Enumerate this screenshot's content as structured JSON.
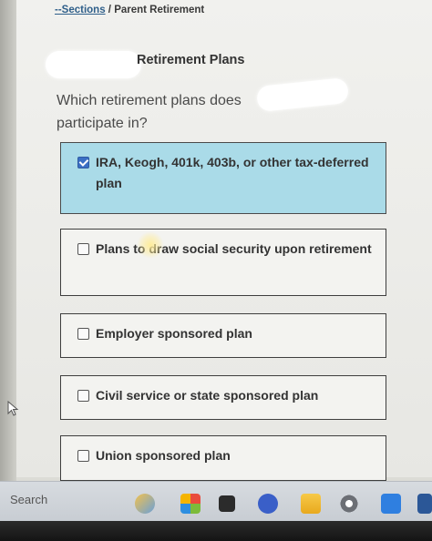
{
  "breadcrumb": {
    "link": "--Sections",
    "separator": " / ",
    "current": "Parent Retirement"
  },
  "page_title": "Retirement Plans",
  "question": {
    "line1": "Which retirement plans does",
    "line2": "participate in?"
  },
  "options": [
    {
      "label": "IRA, Keogh, 401k, 403b, or other tax-deferred plan",
      "checked": true
    },
    {
      "label": "Plans to draw social security upon retirement",
      "checked": false
    },
    {
      "label": "Employer sponsored plan",
      "checked": false
    },
    {
      "label": "Civil service or state sponsored plan",
      "checked": false
    },
    {
      "label": "Union sponsored plan",
      "checked": false
    }
  ],
  "taskbar": {
    "search_label": "Search",
    "icons": [
      "weather-icon",
      "store-icon",
      "file-explorer-icon",
      "video-call-icon",
      "folder-icon",
      "settings-icon",
      "grammarly-icon",
      "word-icon"
    ]
  },
  "colors": {
    "selected_option_bg": "#aadbe8",
    "checkbox_checked": "#3a6fc4",
    "taskbar_bg": "#d7dbe0"
  }
}
